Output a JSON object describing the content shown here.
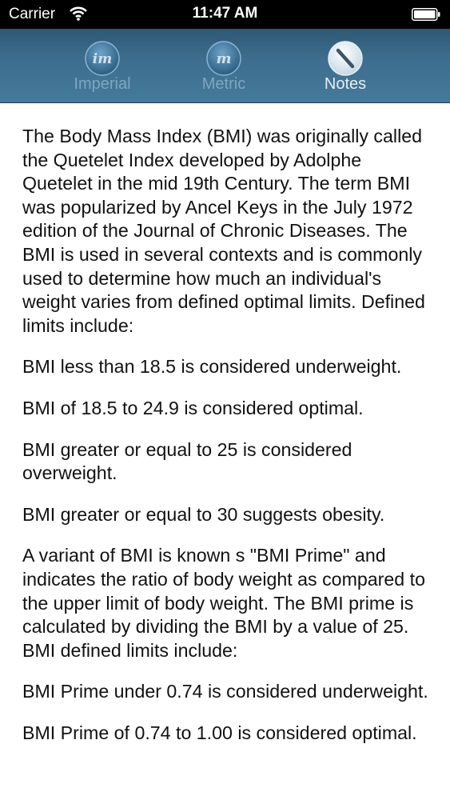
{
  "status_bar": {
    "carrier": "Carrier",
    "time": "11:47 AM"
  },
  "tabs": [
    {
      "label": "Imperial",
      "icon": "im-circle-icon",
      "active": false
    },
    {
      "label": "Metric",
      "icon": "m-circle-icon",
      "active": false
    },
    {
      "label": "Notes",
      "icon": "notes-slash-icon",
      "active": true
    }
  ],
  "colors": {
    "tabbar": "#3d6d8e",
    "tab_label_inactive": "#7fa6c1",
    "tab_label_active": "#e7eef4"
  },
  "notes": {
    "paragraphs": [
      "The Body Mass Index (BMI) was originally called the Quetelet Index developed by Adolphe Quetelet in the mid 19th Century. The term BMI was popularized by Ancel Keys in the July 1972 edition of the Journal of Chronic Diseases. The BMI is used in several contexts and is commonly used to determine how much an individual's weight varies from defined optimal limits. Defined limits include:",
      "BMI less than 18.5 is considered underweight.",
      "BMI of 18.5 to 24.9 is considered optimal.",
      "BMI greater or equal to 25 is considered overweight.",
      "BMI greater or equal to 30 suggests obesity.",
      "A variant of BMI is known s \"BMI Prime\" and indicates the ratio of body weight as compared to the upper limit of body weight. The BMI prime is calculated by dividing the BMI by a value of 25. BMI defined limits include:",
      "BMI Prime under 0.74 is considered underweight.",
      "BMI Prime of 0.74 to 1.00 is considered optimal."
    ]
  }
}
